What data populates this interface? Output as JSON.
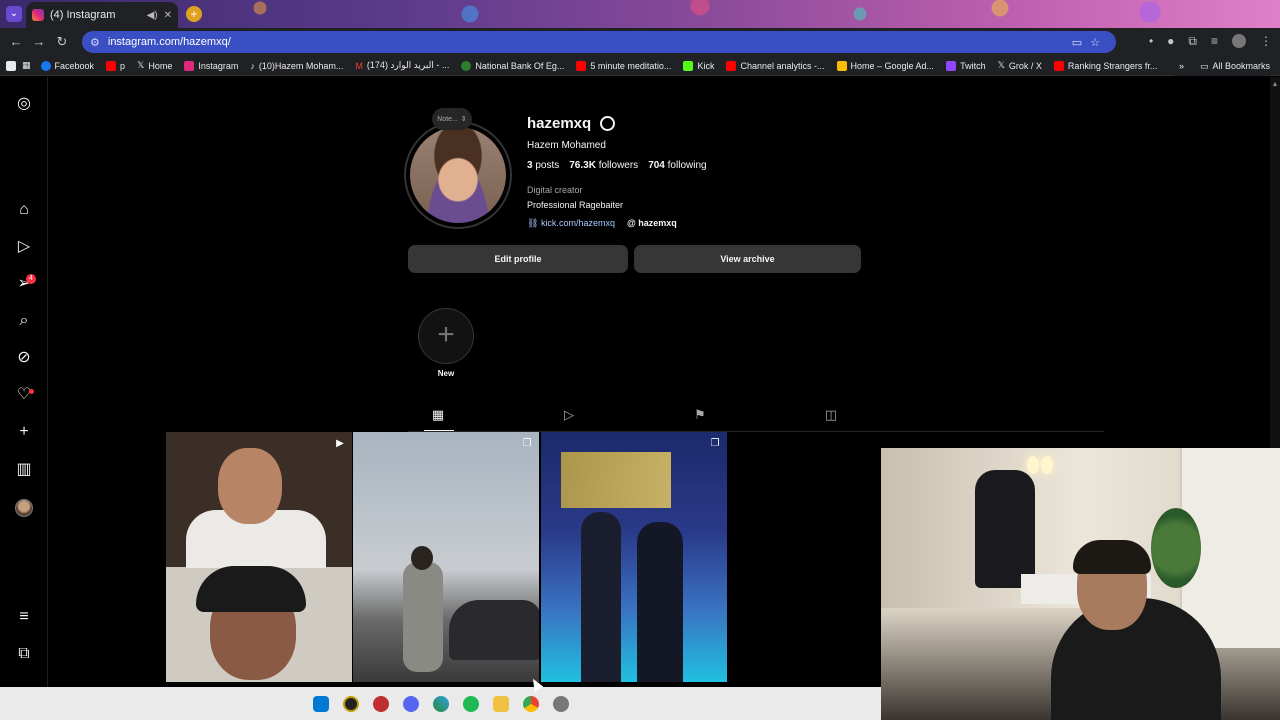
{
  "browser": {
    "tab_title": "(4) Instagram",
    "url": "instagram.com/hazemxq/",
    "bookmarks": [
      {
        "label": "Facebook",
        "color": "#1877f2"
      },
      {
        "label": "p",
        "color": "#ff0000"
      },
      {
        "label": "Home",
        "color": "#e8eaed"
      },
      {
        "label": "Instagram",
        "color": "#dd2a7b"
      },
      {
        "label": "(10)Hazem Moham...",
        "color": "#e8eaed"
      },
      {
        "label": "البريد الوارد (174) - ...",
        "color": "#ea4335"
      },
      {
        "label": "National Bank Of Eg...",
        "color": "#2e7d32"
      },
      {
        "label": "5 minute meditatio...",
        "color": "#ff0000"
      },
      {
        "label": "Kick",
        "color": "#53fc18"
      },
      {
        "label": "Channel analytics -...",
        "color": "#ff0000"
      },
      {
        "label": "Home – Google Ad...",
        "color": "#fbbc04"
      },
      {
        "label": "Twitch",
        "color": "#9146ff"
      },
      {
        "label": "Grok / X",
        "color": "#e8eaed"
      },
      {
        "label": "Ranking Strangers fr...",
        "color": "#ff0000"
      }
    ],
    "all_bookmarks": "All Bookmarks"
  },
  "sidebar": {
    "notifications_badge": "4"
  },
  "profile": {
    "note": "Note...",
    "username": "hazemxq",
    "full_name": "Hazem Mohamed",
    "posts_count": "3",
    "posts_label": "posts",
    "followers_count": "76.3K",
    "followers_label": "followers",
    "following_count": "704",
    "following_label": "following",
    "category": "Digital creator",
    "bio": "Professional Ragebaiter",
    "link": "kick.com/hazemxq",
    "threads_handle": "hazemxq",
    "edit_profile": "Edit profile",
    "view_archive": "View archive",
    "highlight_new": "New"
  }
}
